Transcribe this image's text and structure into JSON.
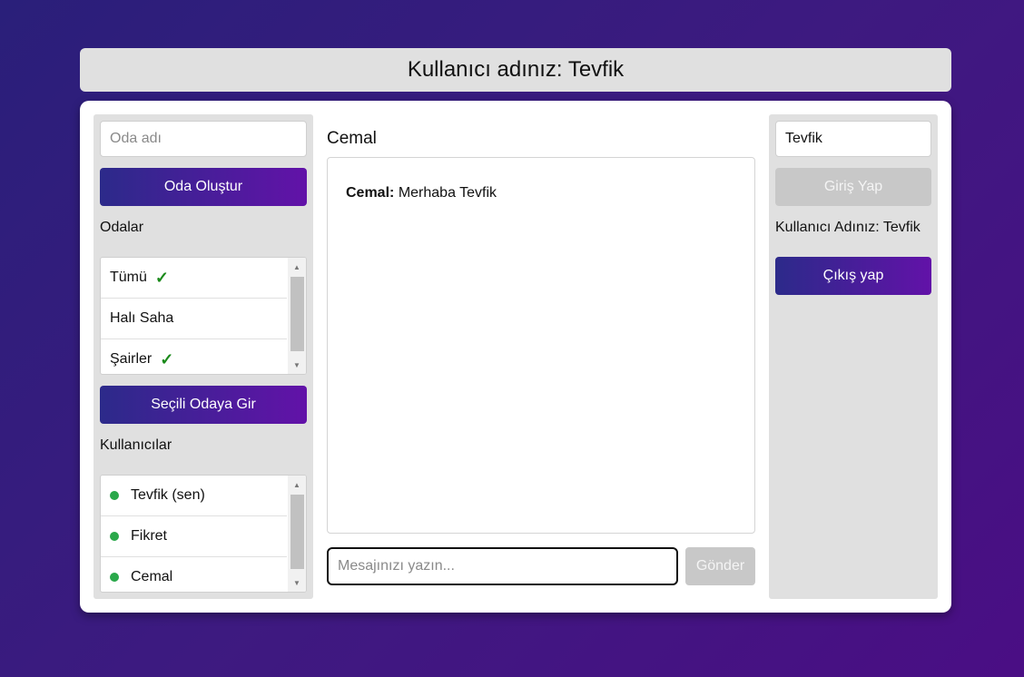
{
  "header": {
    "title": "Kullanıcı adınız: Tevfik"
  },
  "left": {
    "room_name_placeholder": "Oda adı",
    "create_room_label": "Oda Oluştur",
    "rooms_heading": "Odalar",
    "rooms": [
      {
        "name": "Tümü",
        "selected": true
      },
      {
        "name": "Halı Saha",
        "selected": false
      },
      {
        "name": "Şairler",
        "selected": true
      }
    ],
    "check_glyph": "✓",
    "join_room_label": "Seçili Odaya Gir",
    "users_heading": "Kullanıcılar",
    "users": [
      {
        "name": "Tevfik (sen)"
      },
      {
        "name": "Fikret"
      },
      {
        "name": "Cemal"
      }
    ]
  },
  "chat": {
    "room_title": "Cemal",
    "messages": [
      {
        "sender": "Cemal:",
        "text": "Merhaba Tevfik"
      }
    ],
    "input_placeholder": "Mesajınızı yazın...",
    "send_label": "Gönder"
  },
  "right": {
    "username_value": "Tevfik",
    "login_label": "Giriş Yap",
    "username_display": "Kullanıcı Adınız: Tevfik",
    "logout_label": "Çıkış yap"
  },
  "colors": {
    "accent_start": "#2c2a8a",
    "accent_end": "#6212a8",
    "online": "#2aa84a",
    "check": "#1a8a1a"
  }
}
